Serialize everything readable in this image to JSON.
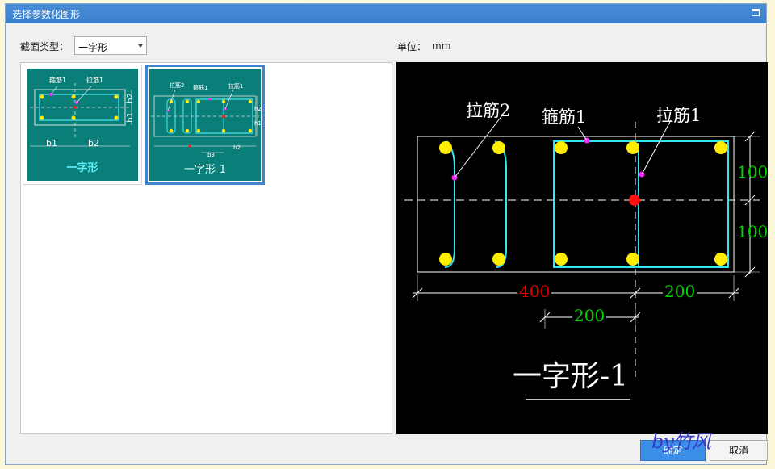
{
  "window": {
    "title": "选择参数化图形"
  },
  "section_type": {
    "label": "截面类型：",
    "value": "一字形"
  },
  "unit": {
    "label": "单位：",
    "value": "mm"
  },
  "thumbnails": [
    {
      "caption": "一字形",
      "labels": [
        "箍筋1",
        "拉筋1",
        "b1",
        "b2",
        "h1",
        "h2"
      ]
    },
    {
      "caption": "一字形-1",
      "labels": [
        "拉筋2",
        "箍筋1",
        "拉筋1",
        "b3",
        "b2",
        "h2",
        "h1"
      ]
    }
  ],
  "preview": {
    "tie2_label": "拉筋2",
    "stirrup1_label": "箍筋1",
    "tie1_label": "拉筋1",
    "dim_h_top": "100",
    "dim_h_bottom": "100",
    "dim_b1": "400",
    "dim_b2": "200",
    "dim_b3": "200",
    "shape_name": "一字形-1",
    "dim_color_red": "#e00000",
    "dim_color_green": "#00d400"
  },
  "buttons": {
    "ok": "确定",
    "cancel": "取消"
  },
  "watermark": "by竹风"
}
